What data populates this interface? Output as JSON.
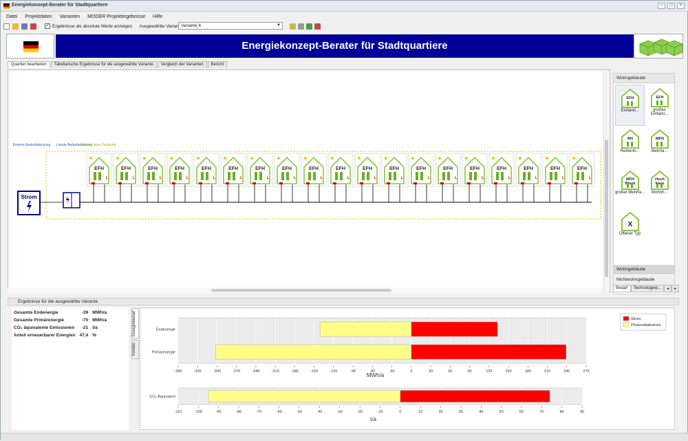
{
  "window": {
    "title": "Energiekonzept-Berater für Stadtquartiere"
  },
  "menu": [
    "Datei",
    "Projektdaten",
    "Varianten",
    "MODER Projektergebnisse",
    "Hilfe"
  ],
  "toolbar": {
    "checkbox_label": "Ergebnisse als absolute Werte anzeigen",
    "checkbox_checked": true,
    "variant_label": "Ausgewählte Variante",
    "variant_value": "Variante 6"
  },
  "banner": {
    "title": "Energiekonzept-Berater für Stadtquartiere",
    "color": "#000099"
  },
  "tabs": [
    "Quartier bearbeiten",
    "Tabellarische Ergebnisse für die ausgewählte Variante",
    "Vergleich der Varianten",
    "Bericht"
  ],
  "diagram": {
    "label_extern": "Externe Bedarfsdeckung",
    "label_lokal": "Lokale Bedarfsdeckung",
    "label_gebaeude": "Bedarf einer Gebäude",
    "source_label": "Strom",
    "house_label": "EFH",
    "house_count": 19
  },
  "palette": {
    "header": "Wohngebäude",
    "items": [
      {
        "tag": "EFH",
        "label": "Einfamil..."
      },
      {
        "tag": "EFH",
        "label": "großes Einfami..."
      },
      {
        "tag": "RH",
        "label": "Reihenh..."
      },
      {
        "tag": "MFH",
        "label": "Mehrfa..."
      },
      {
        "tag": "MFH-Block",
        "label": "großer Mehrfa..."
      },
      {
        "tag": "Hoch-haus",
        "label": "Wohnh..."
      },
      {
        "tag": "X",
        "label": "Offener Typ"
      }
    ],
    "footer1": "Wohngebäude",
    "footer2": "Nichtwohngebäude",
    "tabs": [
      "Bedarf",
      "Technologiep..."
    ]
  },
  "results_title": "Ergebnisse für die ausgewählte Variante",
  "summary": [
    {
      "label": "Gesamte Endenergie",
      "value": "-39",
      "unit": "MWh/a"
    },
    {
      "label": "Gesamte Primärenergie",
      "value": "-70",
      "unit": "MWh/a"
    },
    {
      "label": "CO₂ äquivalente Emissionen",
      "value": "-21",
      "unit": "t/a"
    },
    {
      "label": "Anteil erneuerbarer Energien",
      "value": "47,4",
      "unit": "%"
    }
  ],
  "side_tabs": [
    "Energiebedarf",
    "Kosten"
  ],
  "chart_data": [
    {
      "type": "bar",
      "orientation": "horizontal",
      "stacked": true,
      "categories": [
        "Endenergie",
        "Primärenergie"
      ],
      "series": [
        {
          "name": "Strom",
          "color": "#ff0000",
          "values": [
            133,
            239
          ]
        },
        {
          "name": "Photovoltaikstrom",
          "color": "#ffff88",
          "values": [
            -141,
            -302
          ]
        }
      ],
      "xlabel": "MWh/a",
      "xlim": [
        -360,
        270
      ],
      "xticks": [
        -360,
        -330,
        -300,
        -270,
        -240,
        -210,
        -180,
        -150,
        -120,
        -90,
        -60,
        -30,
        0,
        30,
        60,
        90,
        120,
        150,
        180,
        210,
        240,
        270
      ],
      "legend_position": "top-right"
    },
    {
      "type": "bar",
      "orientation": "horizontal",
      "stacked": true,
      "categories": [
        "CO₂ Äquivalent"
      ],
      "series": [
        {
          "color": "#ff0000",
          "values": [
            74
          ]
        },
        {
          "color": "#ffff88",
          "values": [
            -95
          ]
        }
      ],
      "xlabel": "t/a",
      "xlim": [
        -110,
        90
      ],
      "xticks": [
        -110,
        -100,
        -90,
        -80,
        -70,
        -60,
        -50,
        -40,
        -30,
        -20,
        -10,
        0,
        10,
        20,
        30,
        40,
        50,
        60,
        70,
        80,
        90
      ]
    }
  ]
}
